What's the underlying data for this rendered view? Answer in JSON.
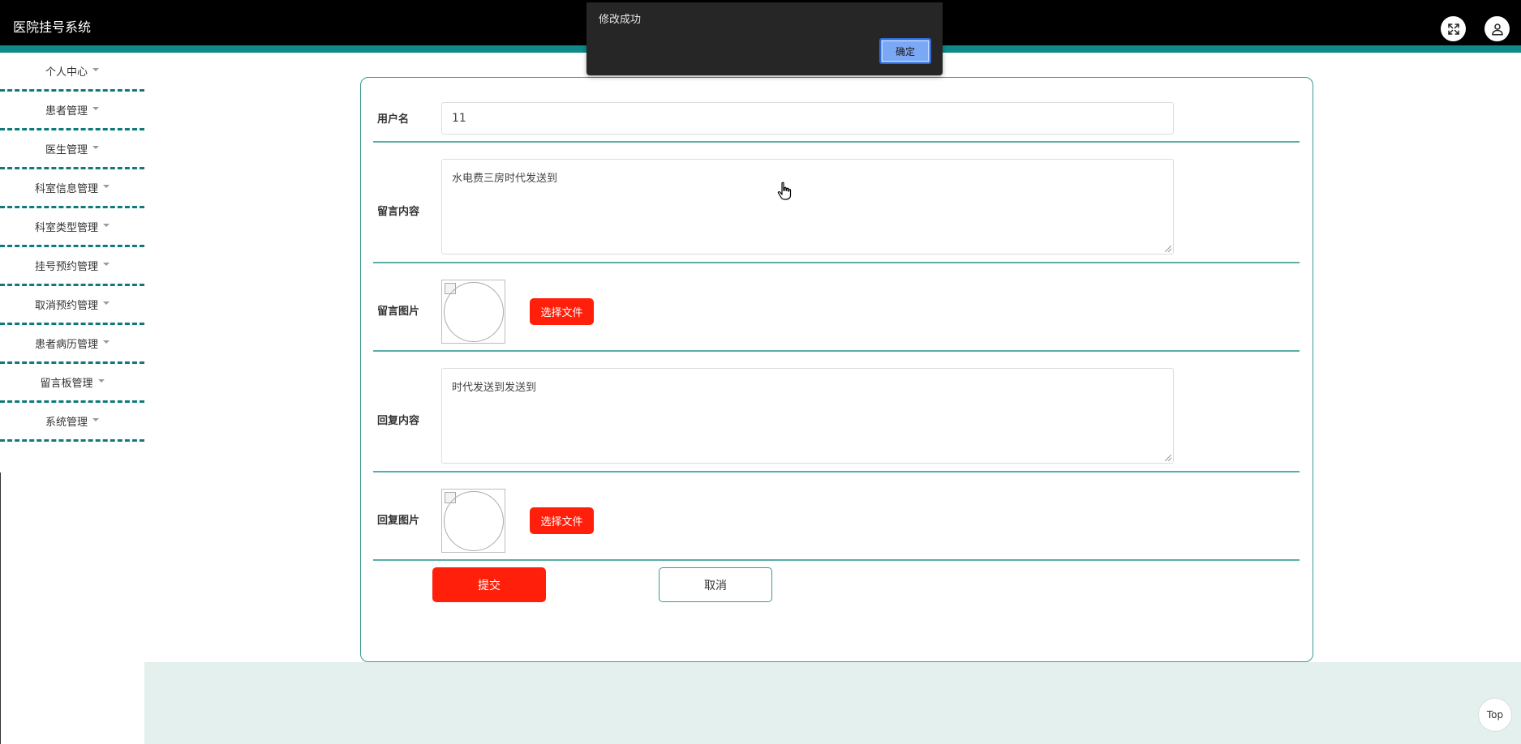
{
  "app": {
    "title": "医院挂号系统"
  },
  "header": {
    "fullscreen_icon": "expand-arrows-icon",
    "user_icon": "user-icon"
  },
  "sidebar": {
    "items": [
      {
        "label": "个人中心"
      },
      {
        "label": "患者管理"
      },
      {
        "label": "医生管理"
      },
      {
        "label": "科室信息管理"
      },
      {
        "label": "科室类型管理"
      },
      {
        "label": "挂号预约管理"
      },
      {
        "label": "取消预约管理"
      },
      {
        "label": "患者病历管理"
      },
      {
        "label": "留言板管理"
      },
      {
        "label": "系统管理"
      }
    ]
  },
  "form": {
    "username_label": "用户名",
    "username_value": "11",
    "message_label": "留言内容",
    "message_value": "水电费三房时代发送到",
    "message_image_label": "留言图片",
    "reply_label": "回复内容",
    "reply_value": "时代发送到发送到",
    "reply_image_label": "回复图片",
    "choose_file_label": "选择文件",
    "submit_label": "提交",
    "cancel_label": "取消"
  },
  "alert": {
    "message": "修改成功",
    "ok_label": "确定"
  },
  "top_button": {
    "label": "Top"
  },
  "colors": {
    "accent": "#0f8a8a",
    "primary_button": "#ff1f0a",
    "footer_bg": "#e4f0ed",
    "topbar": "#000000"
  }
}
